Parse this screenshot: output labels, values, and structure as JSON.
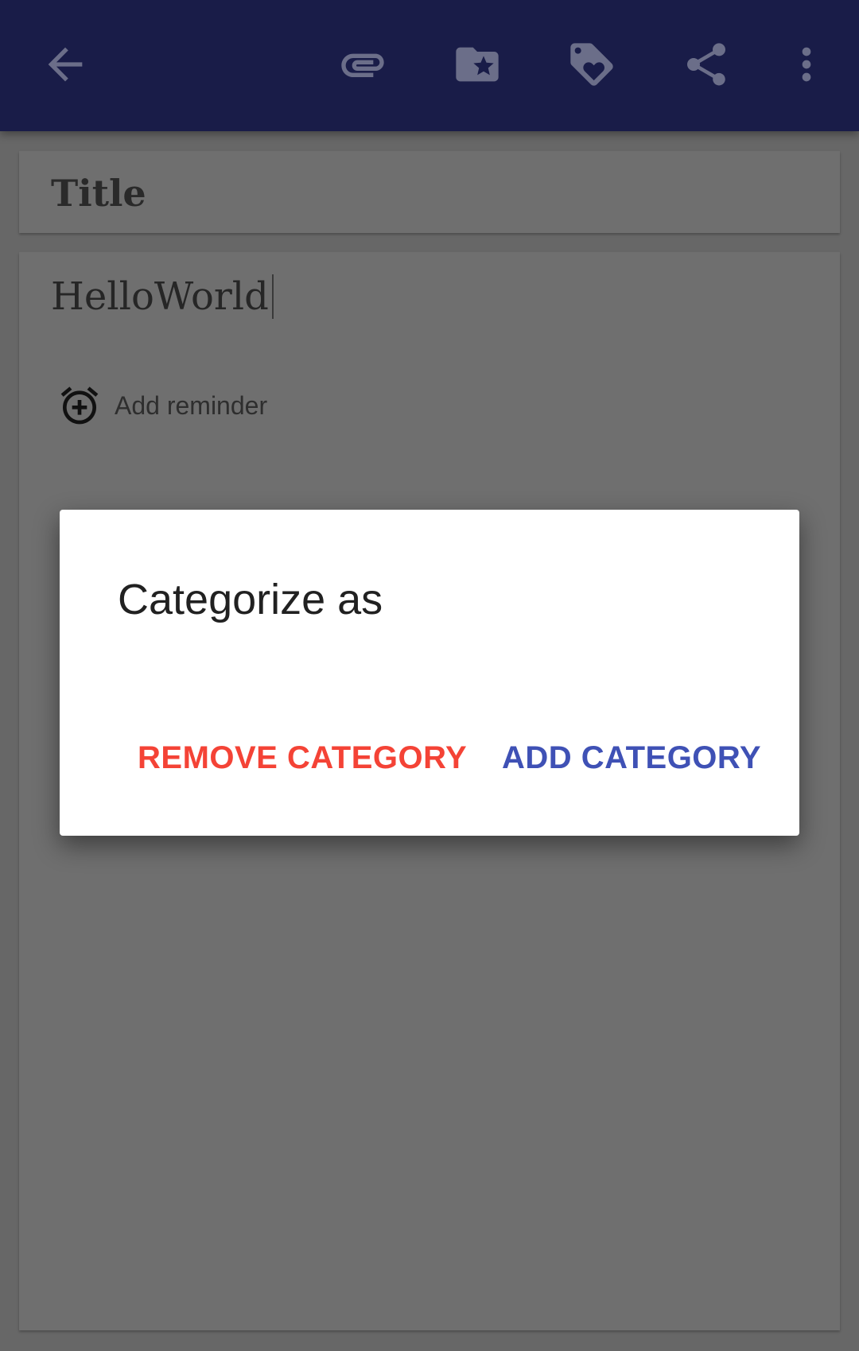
{
  "toolbar": {
    "icons": [
      "back-arrow-icon",
      "attachment-icon",
      "category-folder-icon",
      "tag-icon",
      "share-icon",
      "overflow-menu-icon"
    ]
  },
  "note": {
    "title_placeholder": "Title",
    "content": "HelloWorld",
    "reminder_label": "Add reminder"
  },
  "dialog": {
    "title": "Categorize as",
    "remove_label": "REMOVE CATEGORY",
    "add_label": "ADD CATEGORY"
  },
  "colors": {
    "toolbar_bg": "#191c48",
    "remove_color": "#f44336",
    "add_color": "#3f51b5"
  }
}
